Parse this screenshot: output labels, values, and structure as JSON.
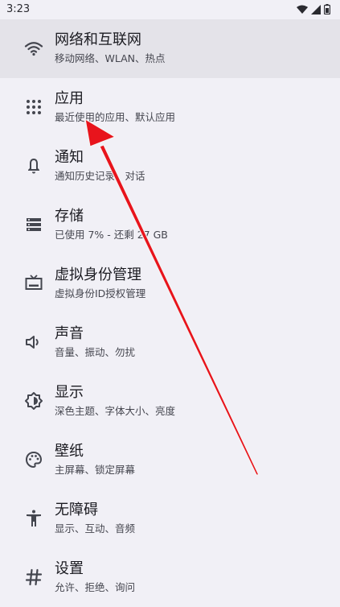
{
  "status_bar": {
    "time": "3:23",
    "icons": [
      "wifi-icon",
      "cellular-signal-icon",
      "battery-icon"
    ]
  },
  "settings": [
    {
      "name": "network",
      "icon": "wifi-icon",
      "title": "网络和互联网",
      "subtitle": "移动网络、WLAN、热点",
      "highlighted": true
    },
    {
      "name": "apps",
      "icon": "apps-grid-icon",
      "title": "应用",
      "subtitle": "最近使用的应用、默认应用"
    },
    {
      "name": "notifications",
      "icon": "bell-icon",
      "title": "通知",
      "subtitle": "通知历史记录、对话"
    },
    {
      "name": "storage",
      "icon": "storage-icon",
      "title": "存储",
      "subtitle": "已使用 7% - 还剩 27 GB"
    },
    {
      "name": "virtual-identity",
      "icon": "tv-icon",
      "title": "虚拟身份管理",
      "subtitle": "虚拟身份ID授权管理"
    },
    {
      "name": "sound",
      "icon": "speaker-icon",
      "title": "声音",
      "subtitle": "音量、振动、勿扰"
    },
    {
      "name": "display",
      "icon": "brightness-icon",
      "title": "显示",
      "subtitle": "深色主题、字体大小、亮度"
    },
    {
      "name": "wallpaper",
      "icon": "palette-icon",
      "title": "壁纸",
      "subtitle": "主屏幕、锁定屏幕"
    },
    {
      "name": "accessibility",
      "icon": "accessibility-icon",
      "title": "无障碍",
      "subtitle": "显示、互动、音频"
    },
    {
      "name": "settings",
      "icon": "hash-icon",
      "title": "设置",
      "subtitle": "允许、拒绝、询问"
    }
  ],
  "annotation": {
    "type": "arrow",
    "color": "#e8141c",
    "points_to": "apps"
  }
}
